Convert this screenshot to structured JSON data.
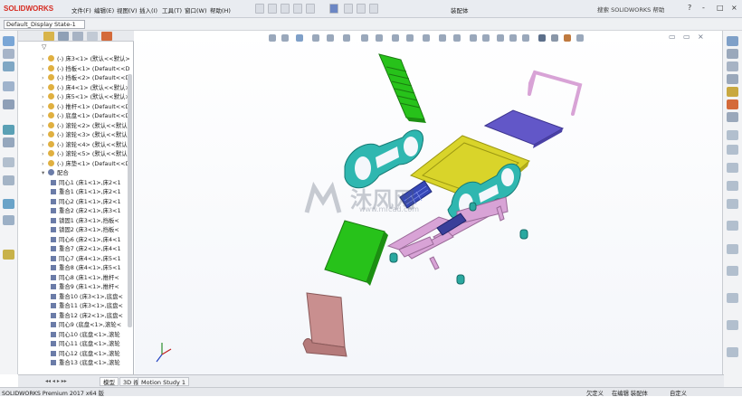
{
  "app": {
    "logo": "SOLIDWORKS",
    "menus": [
      "文件(F)",
      "编辑(E)",
      "视图(V)",
      "插入(I)",
      "工具(T)",
      "窗口(W)",
      "帮助(H)"
    ],
    "doc_title": "装配体",
    "search_placeholder": "搜索 SOLIDWORKS 帮助",
    "window_controls": [
      "?",
      "-",
      "□",
      "×"
    ]
  },
  "config": {
    "display_state": "Default_Display State-1"
  },
  "tree": {
    "filter_icon": "filter-icon",
    "items": [
      {
        "text": "(-) 床3<1> (默认<<默认>",
        "type": "part"
      },
      {
        "text": "(-) 挡板<1> (Default<<D",
        "type": "part"
      },
      {
        "text": "(-) 挡板<2> (Default<<D",
        "type": "part"
      },
      {
        "text": "(-) 床4<1> (默认<<默认>",
        "type": "part"
      },
      {
        "text": "(-) 床5<1> (默认<<默认>",
        "type": "part"
      },
      {
        "text": "(-) 推杆<1> (Default<<D",
        "type": "part"
      },
      {
        "text": "(-) 底盘<1> (Default<<D",
        "type": "part"
      },
      {
        "text": "(-) 滚轮<2> (默认<<默认>",
        "type": "part"
      },
      {
        "text": "(-) 滚轮<3> (默认<<默认>",
        "type": "part"
      },
      {
        "text": "(-) 滚轮<4> (默认<<默认>",
        "type": "part"
      },
      {
        "text": "(-) 滚轮<5> (默认<<默认>",
        "type": "part"
      },
      {
        "text": "(-) 床垫<1> (Default<<D",
        "type": "part"
      },
      {
        "text": "配合",
        "type": "folder"
      },
      {
        "text": "同心1 (床1<1>,床2<1",
        "type": "mate"
      },
      {
        "text": "重合1 (床1<1>,床2<1",
        "type": "mate"
      },
      {
        "text": "同心2 (床1<1>,床2<1",
        "type": "mate"
      },
      {
        "text": "重合2 (床2<1>,床3<1",
        "type": "mate"
      },
      {
        "text": "锁固1 (床3<1>,挡板<",
        "type": "mate"
      },
      {
        "text": "锁固2 (床3<1>,挡板<",
        "type": "mate"
      },
      {
        "text": "同心6 (床2<1>,床4<1",
        "type": "mate"
      },
      {
        "text": "重合7 (床2<1>,床4<1",
        "type": "mate"
      },
      {
        "text": "同心7 (床4<1>,床5<1",
        "type": "mate"
      },
      {
        "text": "重合8 (床4<1>,床5<1",
        "type": "mate"
      },
      {
        "text": "同心8 (床1<1>,推杆<",
        "type": "mate"
      },
      {
        "text": "重合9 (床1<1>,推杆<",
        "type": "mate"
      },
      {
        "text": "重合10 (床3<1>,底盘<",
        "type": "mate"
      },
      {
        "text": "重合11 (床3<1>,底盘<",
        "type": "mate"
      },
      {
        "text": "重合12 (床2<1>,底盘<",
        "type": "mate"
      },
      {
        "text": "同心9 (底盘<1>,滚轮<",
        "type": "mate"
      },
      {
        "text": "同心10 (底盘<1>,滚轮",
        "type": "mate"
      },
      {
        "text": "同心11 (底盘<1>,滚轮",
        "type": "mate"
      },
      {
        "text": "同心12 (底盘<1>,滚轮",
        "type": "mate"
      },
      {
        "text": "重合13 (底盘<1>,滚轮",
        "type": "mate"
      }
    ]
  },
  "bottom_tabs": [
    "模型",
    "3D 视图",
    "Motion Study 1"
  ],
  "status": {
    "left": "SOLIDWORKS Premium 2017 x64 版",
    "undefined": "欠定义",
    "editing": "在编辑 装配体",
    "custom": "自定义"
  },
  "watermark": {
    "text": "沐风网",
    "url": "www.mfcad.com"
  },
  "colors": {
    "accent": "#d62a20",
    "bed_teal": "#2fb7b0",
    "mattress_yellow": "#d9d42a",
    "panel_green": "#27c21a",
    "panel_violet": "#6257c8",
    "frame_pink": "#d8a3d6",
    "backboard_rose": "#c98f8f"
  }
}
